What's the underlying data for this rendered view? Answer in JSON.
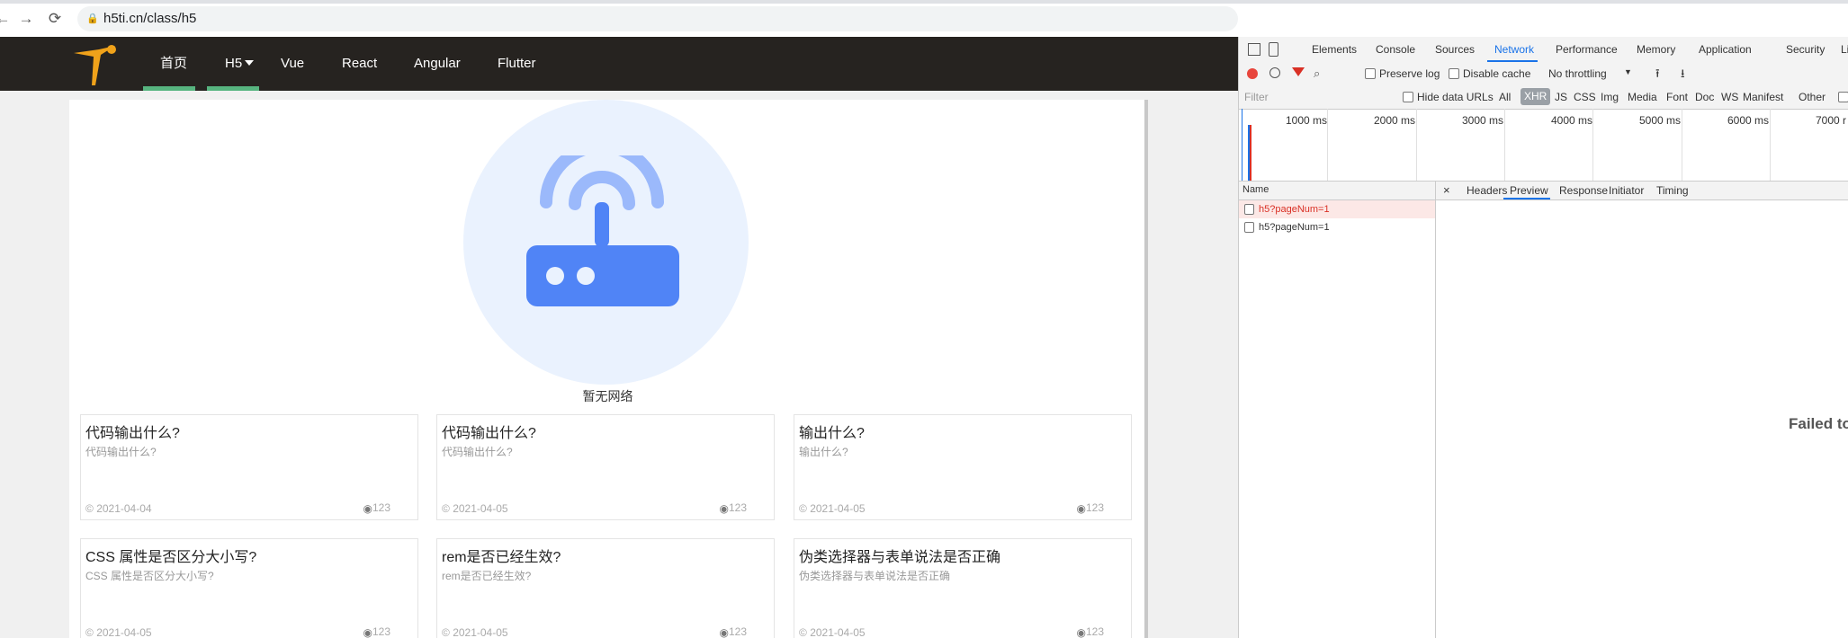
{
  "browser": {
    "back_icon": "arrow-left-icon",
    "forward_icon": "arrow-right-icon",
    "reload_icon": "reload-icon",
    "lock_icon": "lock-icon",
    "url": "h5ti.cn/class/h5"
  },
  "site": {
    "nav": {
      "items": [
        "首页",
        "H5",
        "Vue",
        "React",
        "Angular",
        "Flutter"
      ],
      "dropdown_icon": "caret-down-icon"
    },
    "empty": {
      "icon": "router-wifi-icon",
      "text": "暂无网络"
    },
    "cards": [
      {
        "title": "代码输出什么?",
        "desc": "代码输出什么?",
        "date": "2021-04-04",
        "views": "123"
      },
      {
        "title": "代码输出什么?",
        "desc": "代码输出什么?",
        "date": "2021-04-05",
        "views": "123"
      },
      {
        "title": "输出什么?",
        "desc": "输出什么?",
        "date": "2021-04-05",
        "views": "123"
      },
      {
        "title": "CSS 属性是否区分大小写?",
        "desc": "CSS 属性是否区分大小写?",
        "date": "2021-04-05",
        "views": "123"
      },
      {
        "title": "rem是否已经生效?",
        "desc": "rem是否已经生效?",
        "date": "2021-04-05",
        "views": "123"
      },
      {
        "title": "伪类选择器与表单说法是否正确",
        "desc": "伪类选择器与表单说法是否正确",
        "date": "2021-04-05",
        "views": "123"
      }
    ]
  },
  "devtools": {
    "tabs": [
      "Elements",
      "Console",
      "Sources",
      "Network",
      "Performance",
      "Memory",
      "Application",
      "Security",
      "Li"
    ],
    "active_tab": "Network",
    "toolbar": {
      "preserve_log": "Preserve log",
      "disable_cache": "Disable cache",
      "throttling": "No throttling"
    },
    "filter": {
      "placeholder": "Filter",
      "hide_data_urls": "Hide data URLs",
      "types": [
        "All",
        "XHR",
        "JS",
        "CSS",
        "Img",
        "Media",
        "Font",
        "Doc",
        "WS",
        "Manifest",
        "Other"
      ],
      "active_type": "XHR"
    },
    "timeline_ticks": [
      "1000 ms",
      "2000 ms",
      "3000 ms",
      "4000 ms",
      "5000 ms",
      "6000 ms",
      "7000 r"
    ],
    "requests": {
      "header": "Name",
      "rows": [
        "h5?pageNum=1",
        "h5?pageNum=1"
      ]
    },
    "detail": {
      "close": "×",
      "tabs": [
        "Headers",
        "Preview",
        "Response",
        "Initiator",
        "Timing"
      ],
      "active_tab": "Preview",
      "message": "Failed to loa"
    },
    "colors": {
      "accent": "#1a73e8",
      "error": "#d93025",
      "record": "#e8453c"
    }
  }
}
